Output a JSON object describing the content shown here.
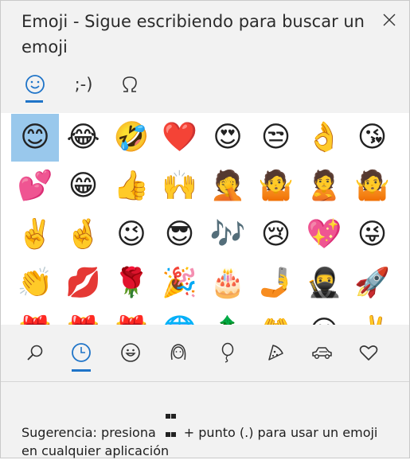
{
  "panel": {
    "title": "Emoji - Sigue escribiendo para buscar un emoji",
    "close_icon": "close-icon"
  },
  "tabs": [
    {
      "name": "emoji",
      "icon": "smiley-icon",
      "active": true
    },
    {
      "name": "kaomoji",
      "label": ";-)",
      "active": false
    },
    {
      "name": "symbols",
      "icon": "omega-icon",
      "active": false
    }
  ],
  "emoji_grid": {
    "selected_index": 0,
    "items": [
      "😊",
      "😂",
      "🤣",
      "❤️",
      "😍",
      "😒",
      "👌",
      "😘",
      "💕",
      "😁",
      "👍",
      "🙌",
      "🤦",
      "🤷",
      "🙎",
      "🤷",
      "✌️",
      "🤞",
      "😉",
      "😎",
      "🎶",
      "😢",
      "💖",
      "😜",
      "👏",
      "💋",
      "🌹",
      "🎉",
      "🎂",
      "🤳",
      "🥷",
      "🚀",
      "🎁",
      "🎁",
      "🎁",
      "🌐",
      "🌲",
      "🤲",
      "😐",
      "✌️"
    ]
  },
  "categories": [
    {
      "name": "search",
      "icon": "search-icon",
      "active": false
    },
    {
      "name": "recent",
      "icon": "clock-icon",
      "active": true
    },
    {
      "name": "smileys",
      "icon": "smiley-face-icon",
      "active": false
    },
    {
      "name": "people",
      "icon": "person-icon",
      "active": false
    },
    {
      "name": "celebration",
      "icon": "balloon-icon",
      "active": false
    },
    {
      "name": "food",
      "icon": "pizza-icon",
      "active": false
    },
    {
      "name": "travel",
      "icon": "car-icon",
      "active": false
    },
    {
      "name": "symbols",
      "icon": "heart-icon",
      "active": false
    }
  ],
  "hint": {
    "before": "Sugerencia: presiona",
    "after": "+ punto (.) para usar un emoji en cualquier aplicación",
    "key_icon": "windows-logo-icon"
  },
  "colors": {
    "accent": "#1f74c8",
    "selected_bg": "#99c8ec",
    "panel_bg": "#f2f2f2"
  }
}
